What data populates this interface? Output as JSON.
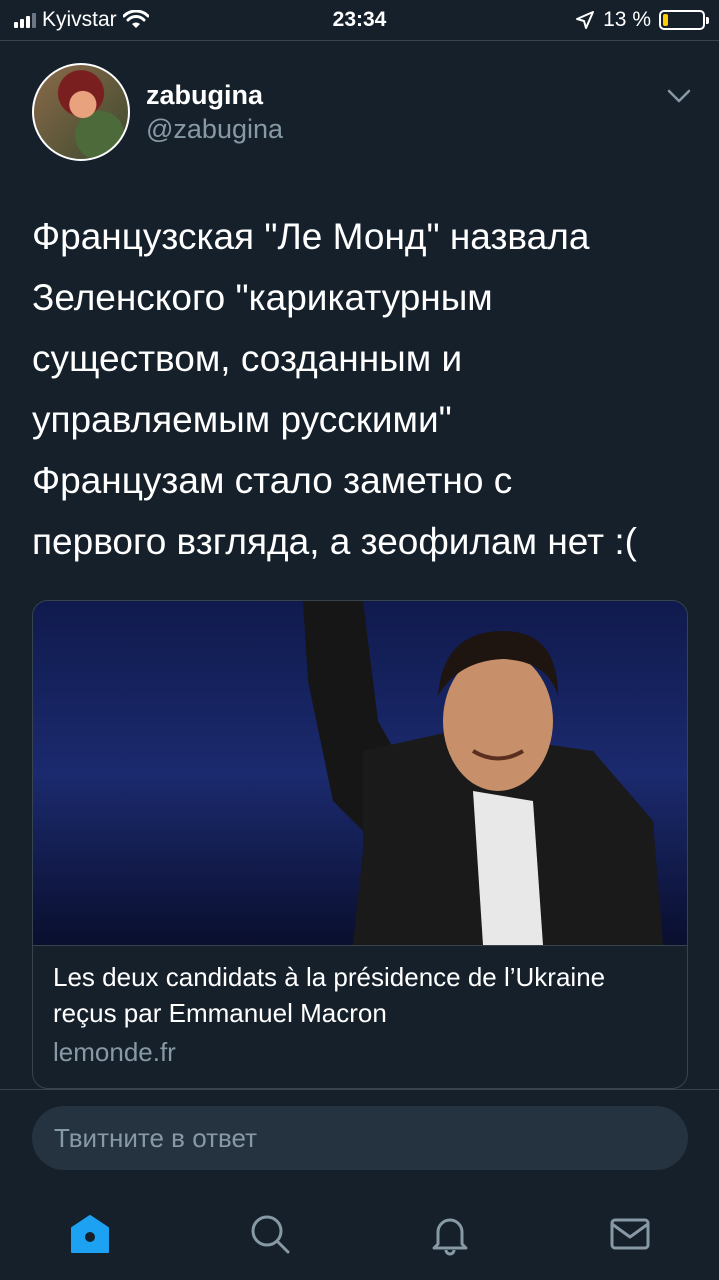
{
  "status_bar": {
    "carrier": "Kyivstar",
    "time": "23:34",
    "battery_percent": "13 %",
    "battery_level": 0.13,
    "signal_bars": 3,
    "icons": [
      "signal-icon",
      "wifi-icon",
      "location-arrow-icon",
      "battery-icon"
    ]
  },
  "tweet": {
    "display_name": "zabugina",
    "handle": "@zabugina",
    "text": "Французская \"Ле Монд\" назвала\nЗеленского \"карикатурным\nсуществом, созданным и\nуправляемым русскими\"\nФранцузам стало заметно с\nпервого взгляда, а зеофилам нет :("
  },
  "card": {
    "title": "Les deux candidats à la présidence de l’Ukraine reçus par Emmanuel Macron",
    "domain": "lemonde.fr"
  },
  "reply": {
    "placeholder": "Твитните в ответ"
  },
  "tab_bar": {
    "items": [
      {
        "icon": "home-icon",
        "active": true
      },
      {
        "icon": "search-icon",
        "active": false
      },
      {
        "icon": "notifications-icon",
        "active": false
      },
      {
        "icon": "messages-icon",
        "active": false
      }
    ]
  },
  "colors": {
    "background": "#15202b",
    "accent": "#1da1f2",
    "secondary_text": "#8899a6",
    "border": "#38444d"
  }
}
